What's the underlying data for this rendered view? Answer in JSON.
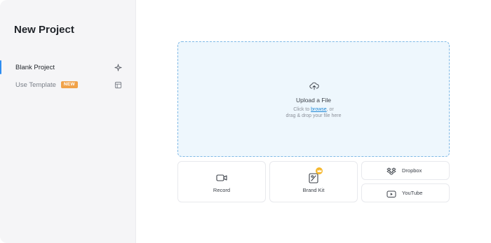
{
  "title": "New Project",
  "sidebar": {
    "items": [
      {
        "label": "Blank Project",
        "icon": "sparkle-icon"
      },
      {
        "label": "Use Template",
        "badge": "NEW",
        "icon": "template-icon"
      }
    ]
  },
  "upload": {
    "title": "Upload a File",
    "line1_prefix": "Click to ",
    "browse": "browse",
    "line1_suffix": ", or",
    "line2": "drag & drop your file here",
    "icon": "cloud-upload-icon"
  },
  "options": {
    "record": {
      "label": "Record",
      "icon": "camera-icon"
    },
    "brand_kit": {
      "label": "Brand Kit",
      "icon": "brand-kit-icon"
    },
    "dropbox": {
      "label": "Dropbox",
      "icon": "dropbox-icon"
    },
    "youtube": {
      "label": "YouTube",
      "icon": "youtube-icon"
    }
  },
  "colors": {
    "accent": "#2d8cf0",
    "upload_bg": "#eef7fd",
    "badge": "#f0a24a",
    "premium": "#f6b72b"
  }
}
